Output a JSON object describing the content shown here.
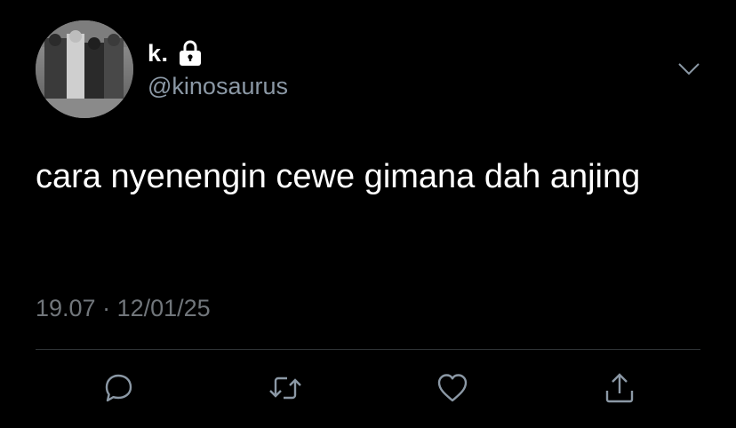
{
  "tweet": {
    "display_name": "k.",
    "handle": "@kinosaurus",
    "text": "cara nyenengin cewe gimana dah anjing",
    "time": "19.07",
    "separator": "·",
    "date": "12/01/25"
  },
  "icons": {
    "avatar": "avatar-photo",
    "protected": "lock-icon",
    "menu": "chevron-down-icon",
    "reply": "reply-icon",
    "retweet": "retweet-icon",
    "like": "like-icon",
    "share": "share-icon"
  },
  "colors": {
    "background": "#000000",
    "primary_text": "#ffffff",
    "secondary_text": "#71767b",
    "handle_text": "#8b98a5",
    "divider": "#2f3336",
    "icon": "#8b98a5"
  }
}
